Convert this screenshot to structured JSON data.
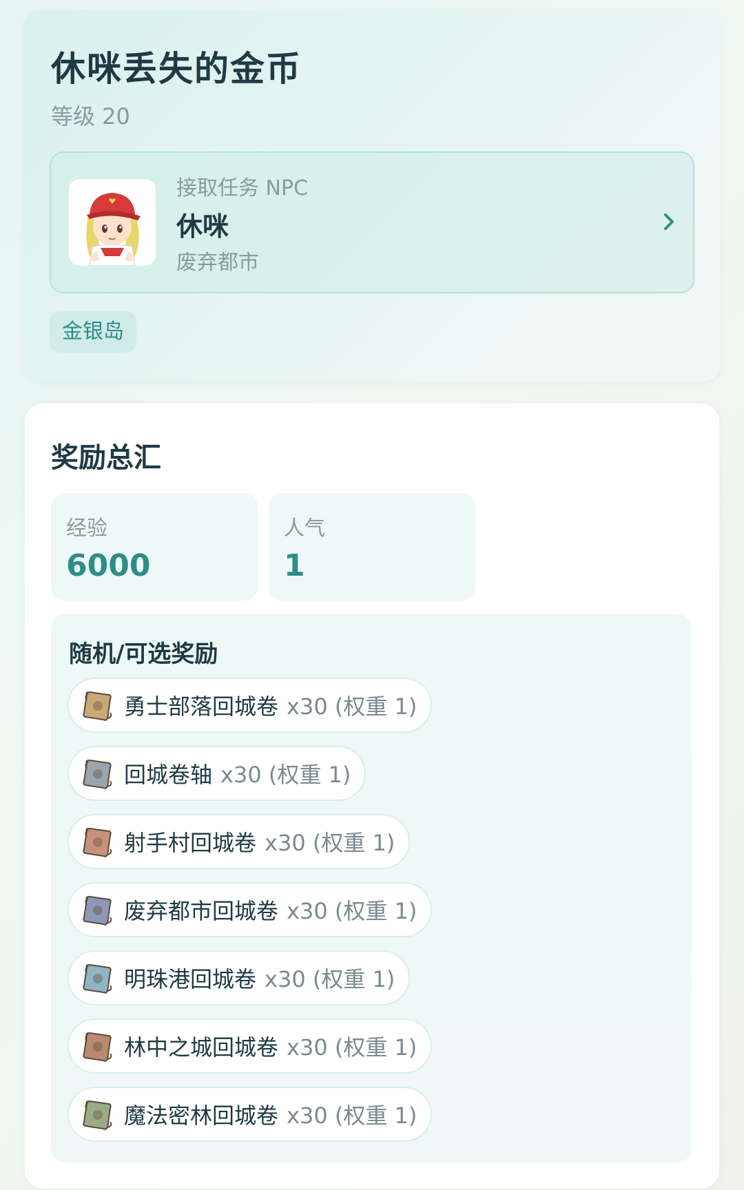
{
  "quest": {
    "title": "休咪丢失的金币",
    "level": "等级 20",
    "npc_caption": "接取任务 NPC",
    "npc_name": "休咪",
    "npc_location": "废弃都市",
    "region_tag": "金银岛"
  },
  "rewards": {
    "title": "奖励总汇",
    "exp_label": "经验",
    "exp_value": "6000",
    "fame_label": "人气",
    "fame_value": "1",
    "random_title": "随机/可选奖励",
    "items": [
      {
        "name": "勇士部落回城卷",
        "qty": "x30 (权重 1)",
        "icon": "scroll-icon",
        "color": "#c9a878"
      },
      {
        "name": "回城卷轴",
        "qty": "x30 (权重 1)",
        "icon": "scroll-icon",
        "color": "#9aa6ae"
      },
      {
        "name": "射手村回城卷",
        "qty": "x30 (权重 1)",
        "icon": "scroll-icon",
        "color": "#c7927c"
      },
      {
        "name": "废弃都市回城卷",
        "qty": "x30 (权重 1)",
        "icon": "scroll-icon",
        "color": "#8e98b4"
      },
      {
        "name": "明珠港回城卷",
        "qty": "x30 (权重 1)",
        "icon": "scroll-icon",
        "color": "#8fb4c2"
      },
      {
        "name": "林中之城回城卷",
        "qty": "x30 (权重 1)",
        "icon": "scroll-icon",
        "color": "#b98a70"
      },
      {
        "name": "魔法密林回城卷",
        "qty": "x30 (权重 1)",
        "icon": "scroll-icon",
        "color": "#98ad86"
      }
    ]
  },
  "colors": {
    "accent": "#2e8e86",
    "title_text": "#1f3a44",
    "muted_text": "#8a9aa0"
  }
}
